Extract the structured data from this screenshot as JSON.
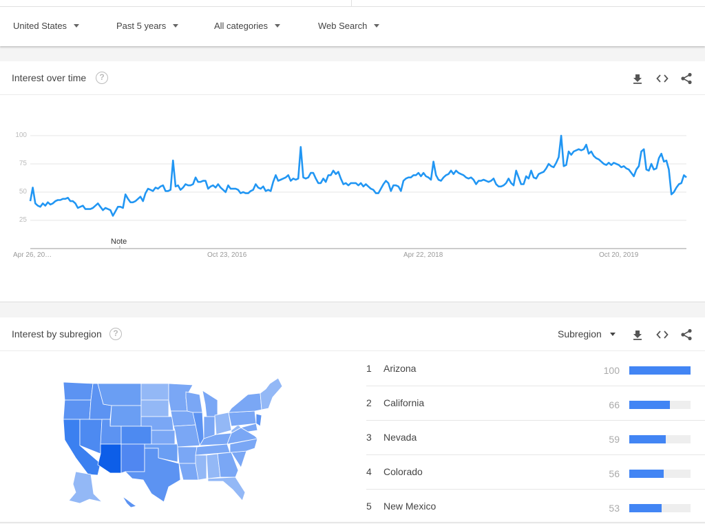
{
  "filters": [
    {
      "label": "United States"
    },
    {
      "label": "Past 5 years"
    },
    {
      "label": "All categories"
    },
    {
      "label": "Web Search"
    }
  ],
  "interest_over_time": {
    "title": "Interest over time",
    "help_icon": "question-circle-icon",
    "actions": [
      "download-icon",
      "embed-code-icon",
      "share-icon"
    ],
    "note_label": "Note"
  },
  "interest_by_subregion": {
    "title": "Interest by subregion",
    "help_icon": "question-circle-icon",
    "dropdown_label": "Subregion",
    "actions": [
      "download-icon",
      "embed-code-icon",
      "share-icon"
    ],
    "rankings": [
      {
        "rank": "1",
        "name": "Arizona",
        "value": "100",
        "fraction": 1.0
      },
      {
        "rank": "2",
        "name": "California",
        "value": "66",
        "fraction": 0.66
      },
      {
        "rank": "3",
        "name": "Nevada",
        "value": "59",
        "fraction": 0.59
      },
      {
        "rank": "4",
        "name": "Colorado",
        "value": "56",
        "fraction": 0.56
      },
      {
        "rank": "5",
        "name": "New Mexico",
        "value": "53",
        "fraction": 0.53
      }
    ],
    "map_colors": {
      "max": "#0d5ee8",
      "high": "#3b80f0",
      "mid": "#5c93f2",
      "low": "#7aa7f5",
      "lowest": "#93b8f6"
    }
  },
  "chart_data": {
    "type": "line",
    "title": "Interest over time",
    "xlabel": "",
    "ylabel": "",
    "ylim": [
      0,
      100
    ],
    "y_ticks": [
      "100",
      "75",
      "50",
      "25"
    ],
    "x_ticks": [
      {
        "label": "Apr 26, 20…",
        "pos": 0.0
      },
      {
        "label": "Oct 23, 2016",
        "pos": 0.3
      },
      {
        "label": "Apr 22, 2018",
        "pos": 0.6
      },
      {
        "label": "Oct 20, 2019",
        "pos": 0.9
      }
    ],
    "grid": true,
    "line_color": "#2196f3",
    "series": [
      {
        "name": "Interest",
        "values": [
          42,
          54,
          40,
          38,
          37,
          40,
          38,
          41,
          39,
          40,
          42,
          43,
          43,
          44,
          44,
          45,
          42,
          42,
          40,
          36,
          37,
          38,
          35,
          35,
          35,
          36,
          38,
          40,
          37,
          34,
          36,
          35,
          34,
          29,
          33,
          37,
          37,
          36,
          48,
          44,
          41,
          41,
          42,
          44,
          46,
          42,
          49,
          53,
          52,
          51,
          54,
          53,
          55,
          56,
          51,
          51,
          52,
          78,
          55,
          56,
          52,
          54,
          57,
          56,
          56,
          57,
          63,
          59,
          59,
          60,
          60,
          53,
          55,
          56,
          54,
          57,
          54,
          52,
          50,
          56,
          53,
          53,
          53,
          52,
          49,
          50,
          49,
          49,
          51,
          52,
          57,
          54,
          53,
          55,
          51,
          52,
          51,
          59,
          65,
          60,
          61,
          62,
          63,
          65,
          60,
          62,
          61,
          62,
          90,
          63,
          62,
          63,
          67,
          67,
          62,
          58,
          58,
          62,
          59,
          65,
          65,
          69,
          66,
          68,
          62,
          57,
          58,
          56,
          58,
          58,
          58,
          56,
          58,
          55,
          57,
          55,
          53,
          52,
          49,
          49,
          53,
          57,
          60,
          58,
          51,
          56,
          56,
          55,
          51,
          60,
          62,
          63,
          63,
          65,
          65,
          67,
          64,
          67,
          64,
          63,
          61,
          77,
          65,
          61,
          60,
          63,
          65,
          66,
          69,
          66,
          69,
          67,
          66,
          65,
          63,
          62,
          63,
          61,
          57,
          60,
          60,
          61,
          60,
          59,
          60,
          62,
          57,
          55,
          55,
          56,
          58,
          62,
          58,
          56,
          69,
          63,
          57,
          57,
          64,
          62,
          69,
          63,
          62,
          66,
          67,
          68,
          71,
          75,
          73,
          72,
          76,
          81,
          100,
          73,
          74,
          86,
          83,
          86,
          87,
          88,
          87,
          88,
          92,
          84,
          86,
          82,
          80,
          79,
          77,
          75,
          74,
          76,
          74,
          76,
          75,
          74,
          72,
          73,
          71,
          70,
          67,
          64,
          70,
          73,
          86,
          88,
          70,
          69,
          75,
          70,
          71,
          80,
          84,
          77,
          78,
          70,
          48,
          50,
          54,
          57,
          58,
          65,
          63
        ],
        "start_label": "Apr 26, 2015"
      }
    ]
  }
}
